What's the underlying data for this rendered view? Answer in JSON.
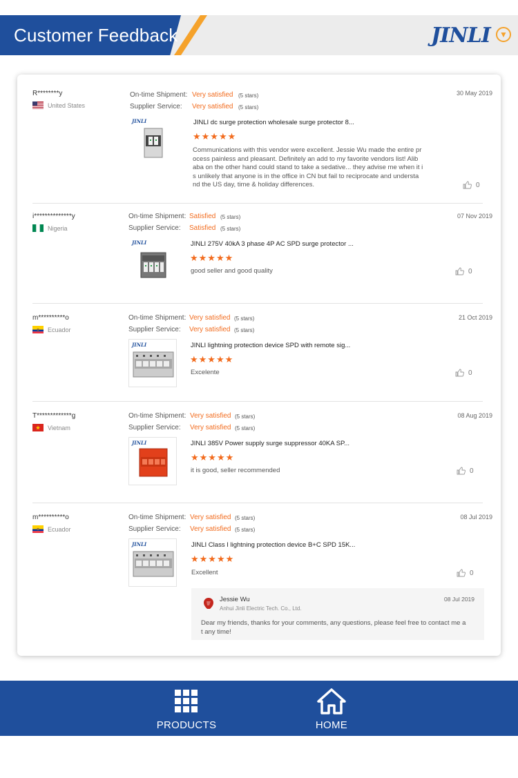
{
  "header": {
    "title": "Customer Feedback",
    "logo_text": "JINLI"
  },
  "reviews": [
    {
      "name": "R********y",
      "country": "United States",
      "flag": "us",
      "shipment_label": "On-time Shipment:",
      "shipment_value": "Very satisfied",
      "shipment_stars": "(5 stars)",
      "service_label": "Supplier Service:",
      "service_value": "Very satisfied",
      "service_stars": "(5 stars)",
      "date": "30 May 2019",
      "product_title": "JINLI dc surge protection wholesale surge protector 8...",
      "rating": "★★★★★",
      "comment_lines": [
        "Communications with this vendor were excellent. Jessie Wu made the entire pr",
        "ocess painless and pleasant. Definitely an add to my favorite vendors list! Alib",
        "aba on the other hand could stand to take a sedative... they advise me when it i",
        "s unlikely that anyone is in the office in CN but fail to reciprocate and understa",
        "nd the US day, time & holiday differences."
      ],
      "likes": "0"
    },
    {
      "name": "i**************y",
      "country": "Nigeria",
      "flag": "ng",
      "shipment_label": "On-time Shipment:",
      "shipment_value": "Satisfied",
      "shipment_stars": "(5 stars)",
      "service_label": "Supplier Service:",
      "service_value": "Satisfied",
      "service_stars": "(5 stars)",
      "date": "07 Nov 2019",
      "product_title": "JINLI 275V 40kA 3 phase 4P AC SPD surge protector ...",
      "rating": "★★★★★",
      "comment_lines": [
        "good seller and good quality"
      ],
      "likes": "0"
    },
    {
      "name": "m**********o",
      "country": "Ecuador",
      "flag": "ec",
      "shipment_label": "On-time Shipment:",
      "shipment_value": "Very satisfied",
      "shipment_stars": "(5 stars)",
      "service_label": "Supplier Service:",
      "service_value": "Very satisfied",
      "service_stars": "(5 stars)",
      "date": "21 Oct 2019",
      "product_title": "JINLI lightning protection device SPD with remote sig...",
      "rating": "★★★★★",
      "comment_lines": [
        "Excelente"
      ],
      "likes": "0"
    },
    {
      "name": "T*************g",
      "country": "Vietnam",
      "flag": "vn",
      "shipment_label": "On-time Shipment:",
      "shipment_value": "Very satisfied",
      "shipment_stars": "(5 stars)",
      "service_label": "Supplier Service:",
      "service_value": "Very satisfied",
      "service_stars": "(5 stars)",
      "date": "08 Aug 2019",
      "product_title": "JINLI 385V Power supply surge suppressor 40KA SP...",
      "rating": "★★★★★",
      "comment_lines": [
        "it is good, seller recommended"
      ],
      "likes": "0"
    },
    {
      "name": "m**********o",
      "country": "Ecuador",
      "flag": "ec",
      "shipment_label": "On-time Shipment:",
      "shipment_value": "Very satisfied",
      "shipment_stars": "(5 stars)",
      "service_label": "Supplier Service:",
      "service_value": "Very satisfied",
      "service_stars": "(5 stars)",
      "date": "08 Jul 2019",
      "product_title": "JINLI Class I lightning protection device B+C SPD 15K...",
      "rating": "★★★★★",
      "comment_lines": [
        "Excellent"
      ],
      "likes": "0"
    }
  ],
  "reply": {
    "name": "Jessie Wu",
    "company": "Anhui Jinli Electric Tech. Co., Ltd.",
    "date": "08 Jul 2019",
    "text_lines": [
      "Dear my friends, thanks for your comments, any questions, please feel free to contact me a",
      "t any time!"
    ]
  },
  "nav": {
    "products_label": "PRODUCTS",
    "home_label": "HOME"
  },
  "colors": {
    "brand_blue": "#1f4f9c",
    "accent_orange": "#f5a22b",
    "satisfied_orange": "#f26b1d"
  }
}
